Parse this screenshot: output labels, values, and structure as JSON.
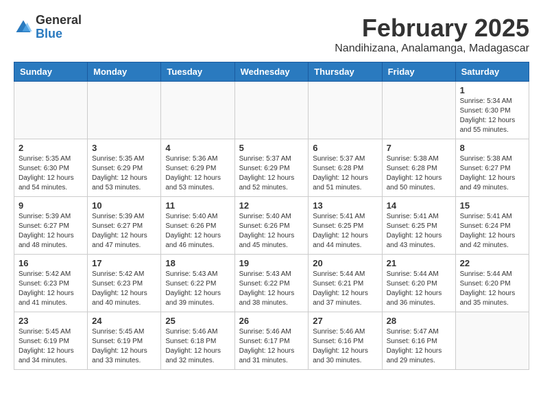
{
  "header": {
    "logo_general": "General",
    "logo_blue": "Blue",
    "month_title": "February 2025",
    "location": "Nandihizana, Analamanga, Madagascar"
  },
  "days_of_week": [
    "Sunday",
    "Monday",
    "Tuesday",
    "Wednesday",
    "Thursday",
    "Friday",
    "Saturday"
  ],
  "weeks": [
    [
      {
        "day": "",
        "info": ""
      },
      {
        "day": "",
        "info": ""
      },
      {
        "day": "",
        "info": ""
      },
      {
        "day": "",
        "info": ""
      },
      {
        "day": "",
        "info": ""
      },
      {
        "day": "",
        "info": ""
      },
      {
        "day": "1",
        "info": "Sunrise: 5:34 AM\nSunset: 6:30 PM\nDaylight: 12 hours and 55 minutes."
      }
    ],
    [
      {
        "day": "2",
        "info": "Sunrise: 5:35 AM\nSunset: 6:30 PM\nDaylight: 12 hours and 54 minutes."
      },
      {
        "day": "3",
        "info": "Sunrise: 5:35 AM\nSunset: 6:29 PM\nDaylight: 12 hours and 53 minutes."
      },
      {
        "day": "4",
        "info": "Sunrise: 5:36 AM\nSunset: 6:29 PM\nDaylight: 12 hours and 53 minutes."
      },
      {
        "day": "5",
        "info": "Sunrise: 5:37 AM\nSunset: 6:29 PM\nDaylight: 12 hours and 52 minutes."
      },
      {
        "day": "6",
        "info": "Sunrise: 5:37 AM\nSunset: 6:28 PM\nDaylight: 12 hours and 51 minutes."
      },
      {
        "day": "7",
        "info": "Sunrise: 5:38 AM\nSunset: 6:28 PM\nDaylight: 12 hours and 50 minutes."
      },
      {
        "day": "8",
        "info": "Sunrise: 5:38 AM\nSunset: 6:27 PM\nDaylight: 12 hours and 49 minutes."
      }
    ],
    [
      {
        "day": "9",
        "info": "Sunrise: 5:39 AM\nSunset: 6:27 PM\nDaylight: 12 hours and 48 minutes."
      },
      {
        "day": "10",
        "info": "Sunrise: 5:39 AM\nSunset: 6:27 PM\nDaylight: 12 hours and 47 minutes."
      },
      {
        "day": "11",
        "info": "Sunrise: 5:40 AM\nSunset: 6:26 PM\nDaylight: 12 hours and 46 minutes."
      },
      {
        "day": "12",
        "info": "Sunrise: 5:40 AM\nSunset: 6:26 PM\nDaylight: 12 hours and 45 minutes."
      },
      {
        "day": "13",
        "info": "Sunrise: 5:41 AM\nSunset: 6:25 PM\nDaylight: 12 hours and 44 minutes."
      },
      {
        "day": "14",
        "info": "Sunrise: 5:41 AM\nSunset: 6:25 PM\nDaylight: 12 hours and 43 minutes."
      },
      {
        "day": "15",
        "info": "Sunrise: 5:41 AM\nSunset: 6:24 PM\nDaylight: 12 hours and 42 minutes."
      }
    ],
    [
      {
        "day": "16",
        "info": "Sunrise: 5:42 AM\nSunset: 6:23 PM\nDaylight: 12 hours and 41 minutes."
      },
      {
        "day": "17",
        "info": "Sunrise: 5:42 AM\nSunset: 6:23 PM\nDaylight: 12 hours and 40 minutes."
      },
      {
        "day": "18",
        "info": "Sunrise: 5:43 AM\nSunset: 6:22 PM\nDaylight: 12 hours and 39 minutes."
      },
      {
        "day": "19",
        "info": "Sunrise: 5:43 AM\nSunset: 6:22 PM\nDaylight: 12 hours and 38 minutes."
      },
      {
        "day": "20",
        "info": "Sunrise: 5:44 AM\nSunset: 6:21 PM\nDaylight: 12 hours and 37 minutes."
      },
      {
        "day": "21",
        "info": "Sunrise: 5:44 AM\nSunset: 6:20 PM\nDaylight: 12 hours and 36 minutes."
      },
      {
        "day": "22",
        "info": "Sunrise: 5:44 AM\nSunset: 6:20 PM\nDaylight: 12 hours and 35 minutes."
      }
    ],
    [
      {
        "day": "23",
        "info": "Sunrise: 5:45 AM\nSunset: 6:19 PM\nDaylight: 12 hours and 34 minutes."
      },
      {
        "day": "24",
        "info": "Sunrise: 5:45 AM\nSunset: 6:19 PM\nDaylight: 12 hours and 33 minutes."
      },
      {
        "day": "25",
        "info": "Sunrise: 5:46 AM\nSunset: 6:18 PM\nDaylight: 12 hours and 32 minutes."
      },
      {
        "day": "26",
        "info": "Sunrise: 5:46 AM\nSunset: 6:17 PM\nDaylight: 12 hours and 31 minutes."
      },
      {
        "day": "27",
        "info": "Sunrise: 5:46 AM\nSunset: 6:16 PM\nDaylight: 12 hours and 30 minutes."
      },
      {
        "day": "28",
        "info": "Sunrise: 5:47 AM\nSunset: 6:16 PM\nDaylight: 12 hours and 29 minutes."
      },
      {
        "day": "",
        "info": ""
      }
    ]
  ]
}
